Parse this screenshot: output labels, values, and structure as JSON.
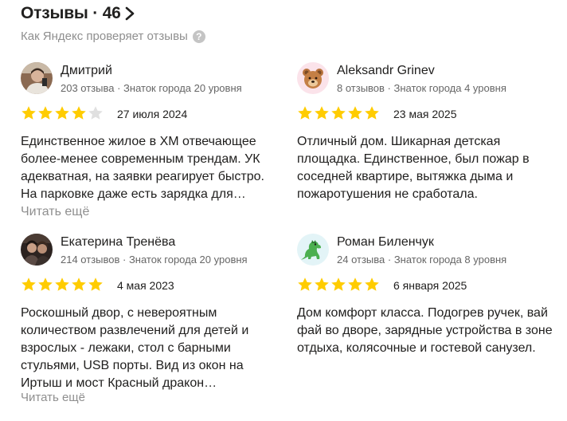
{
  "header": {
    "title": "Отзывы · 46",
    "verify_text": "Как Яндекс проверяет отзывы",
    "help_glyph": "?"
  },
  "reviews": [
    {
      "author": "Дмитрий",
      "meta": "203 отзыва · Знаток города 20 уровня",
      "rating": 4,
      "date": "27 июля 2024",
      "text": "Единственное жилое в ХМ отвечающее более-менее современным трендам. УК адекватная, на заявки реагирует быстро. На парковке даже есть зарядка для…",
      "more": "Читать ещё",
      "avatar": "photo-avatar"
    },
    {
      "author": "Aleksandr Grinev",
      "meta": "8 отзывов · Знаток города 4 уровня",
      "rating": 5,
      "date": "23 мая 2025",
      "text": "Отличный дом. Шикарная детская площадка. Единственное, был пожар в соседней квартире, вытяжка дыма и пожаротушения не сработала.",
      "avatar": "bear-icon"
    },
    {
      "author": "Екатерина Тренёва",
      "meta": "214 отзывов · Знаток города 20 уровня",
      "rating": 5,
      "date": "4 мая 2023",
      "text": "Роскошный двор, с невероятным количеством развлечений для детей и взрослых - лежаки, стол с барными стульями, USB порты. Вид из окон на Иртыш и мост Красный дракон…",
      "more": "Читать ещё",
      "avatar": "photo-avatar"
    },
    {
      "author": "Роман Биленчук",
      "meta": "24 отзыва · Знаток города 8 уровня",
      "rating": 5,
      "date": "6 января 2025",
      "text": "Дом комфорт класса. Подогрев ручек, вай фай во дворе, зарядные устройства в зоне отдыха, колясочные и гостевой санузел.",
      "avatar": "dinosaur-icon"
    }
  ],
  "colors": {
    "star_filled": "#fc0",
    "star_empty": "#e0e0e0",
    "muted": "#8f8f8f"
  }
}
